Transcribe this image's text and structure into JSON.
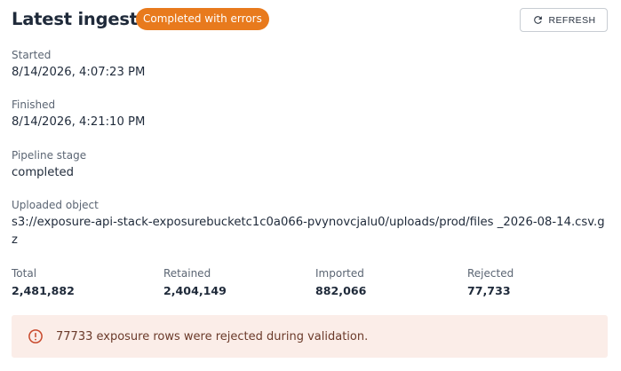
{
  "header": {
    "title": "Latest ingest",
    "status_badge": "Completed with errors",
    "refresh_label": "REFRESH"
  },
  "fields": {
    "started": {
      "label": "Started",
      "value": "8/14/2026, 4:07:23 PM"
    },
    "finished": {
      "label": "Finished",
      "value": "8/14/2026, 4:21:10 PM"
    },
    "pipeline_stage": {
      "label": "Pipeline stage",
      "value": "completed"
    },
    "uploaded_object": {
      "label": "Uploaded object",
      "value": "s3://exposure-api-stack-exposurebucketc1c0a066-pvynovcjalu0/uploads/prod/files _2026-08-14.csv.gz"
    }
  },
  "stats": {
    "total": {
      "label": "Total",
      "value": "2,481,882"
    },
    "retained": {
      "label": "Retained",
      "value": "2,404,149"
    },
    "imported": {
      "label": "Imported",
      "value": "882,066"
    },
    "rejected": {
      "label": "Rejected",
      "value": "77,733"
    }
  },
  "alert": {
    "icon": "error-circle-icon",
    "message": "77733 exposure rows were rejected during validation."
  },
  "colors": {
    "badge_bg": "#e87a1d",
    "alert_bg": "#fbede8",
    "alert_icon": "#c8482b"
  }
}
